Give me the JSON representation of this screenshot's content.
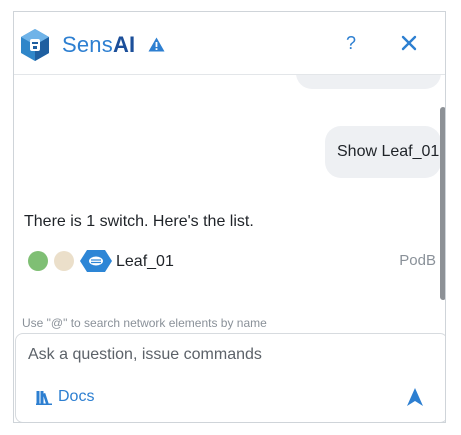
{
  "header": {
    "brand_prefix": "Sens",
    "brand_suffix": "AI",
    "help_label": "?"
  },
  "chat": {
    "user_message": "Show Leaf_01",
    "bot_message": "There is 1 switch. Here's the list.",
    "results": [
      {
        "name": "Leaf_01",
        "pod": "PodB",
        "status_colors": [
          "#7fbf74",
          "#ebdfca"
        ]
      }
    ]
  },
  "composer": {
    "hint": "Use \"@\" to search network elements by name",
    "placeholder": "Ask a question, issue commands",
    "docs_label": "Docs"
  },
  "colors": {
    "accent": "#2d7fd1",
    "brand_dark": "#1c4f9a",
    "bubble": "#eef0f3"
  }
}
